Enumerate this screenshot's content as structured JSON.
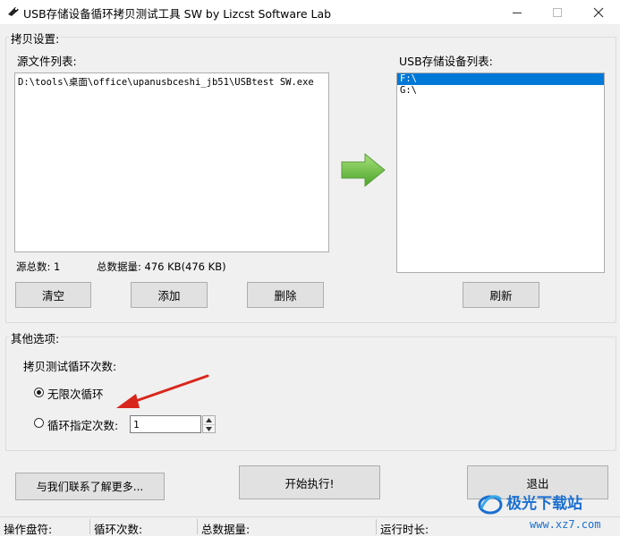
{
  "window": {
    "title": "USB存储设备循环拷贝测试工具 SW  by Lizcst Software Lab",
    "controls": {
      "minimize_icon": "minimize-icon",
      "maximize_icon": "maximize-icon",
      "close_icon": "close-icon"
    }
  },
  "copy_settings": {
    "group_title": "拷贝设置:",
    "source_list_label": "源文件列表:",
    "source_files": [
      "D:\\tools\\桌面\\office\\upanusbceshi_jb51\\USBtest SW.exe"
    ],
    "source_count_text": "源总数: 1",
    "total_size_text": "总数据量: 476 KB(476 KB)",
    "buttons": {
      "clear": "清空",
      "add": "添加",
      "delete": "删除",
      "refresh": "刷新"
    },
    "usb_list_label": "USB存储设备列表:",
    "usb_devices": [
      {
        "label": "F:\\",
        "selected": true
      },
      {
        "label": "G:\\",
        "selected": false
      }
    ],
    "arrow_icon": "green-arrow-right-icon"
  },
  "other_options": {
    "group_title": "其他选项:",
    "loop_label": "拷贝测试循环次数:",
    "radio_unlimited": "无限次循环",
    "radio_specified": "循环指定次数:",
    "selected_mode": "unlimited",
    "loop_count_value": "1"
  },
  "actions": {
    "contact": "与我们联系了解更多...",
    "start": "开始执行!",
    "exit": "退出"
  },
  "status_bar": {
    "drive": "操作盘符:",
    "loops": "循环次数:",
    "total_data": "总数据量:",
    "runtime": "运行时长:"
  },
  "watermark": {
    "brand": "极光下载站",
    "url": "www.xz7.com"
  },
  "colors": {
    "selection": "#0078d7",
    "arrow_green": "#6cc13b",
    "annotation_arrow": "#d9261c",
    "watermark_blue": "#1b6fd0"
  }
}
